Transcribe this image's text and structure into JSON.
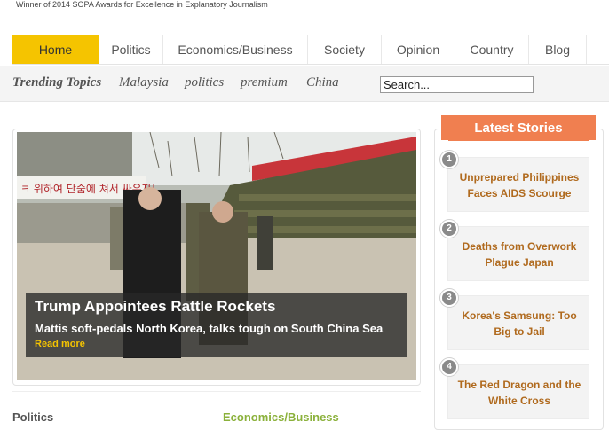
{
  "header": {
    "award_text": "Winner of 2014 SOPA Awards for Excellence in Explanatory Journalism"
  },
  "nav": {
    "items": [
      "Home",
      "Politics",
      "Economics/Business",
      "Society",
      "Opinion",
      "Country",
      "Blog"
    ],
    "active": "Home",
    "active_color": "#f5c400"
  },
  "trending": {
    "title": "Trending Topics",
    "topics": [
      "Malaysia",
      "politics",
      "premium",
      "China"
    ]
  },
  "search": {
    "value": "Search..."
  },
  "feature": {
    "title": "Trump Appointees Rattle Rockets",
    "subtitle": "Mattis soft-pedals North Korea, talks tough on South China Sea",
    "read_more": "Read more",
    "image_banner_text": "ㅋ 위하여 단숨에 쳐서 싸우자!"
  },
  "sidebar": {
    "heading": "Latest Stories",
    "heading_color": "#f07f50",
    "stories": [
      {
        "num": "1",
        "title": "Unprepared Philippines Faces AIDS Scourge"
      },
      {
        "num": "2",
        "title": "Deaths from Overwork Plague Japan"
      },
      {
        "num": "3",
        "title": "Korea's Samsung: Too Big to Jail"
      },
      {
        "num": "4",
        "title": "The Red Dragon and the White Cross"
      }
    ]
  },
  "sections": {
    "left": "Politics",
    "right": "Economics/Business",
    "right_color": "#8bb13b"
  }
}
